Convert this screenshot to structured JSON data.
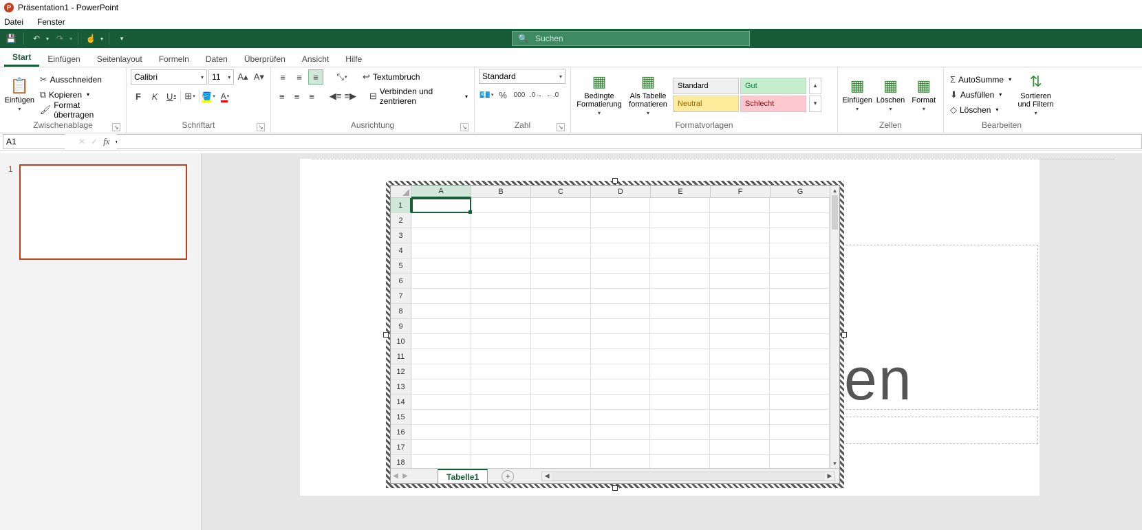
{
  "titlebar": {
    "title": "Präsentation1 - PowerPoint"
  },
  "menubar": {
    "file": "Datei",
    "window": "Fenster"
  },
  "search": {
    "placeholder": "Suchen"
  },
  "tabs": {
    "start": "Start",
    "insert": "Einfügen",
    "pagelayout": "Seitenlayout",
    "formulas": "Formeln",
    "data": "Daten",
    "review": "Überprüfen",
    "view": "Ansicht",
    "help": "Hilfe"
  },
  "clipboard": {
    "paste": "Einfügen",
    "cut": "Ausschneiden",
    "copy": "Kopieren",
    "format_painter": "Format übertragen",
    "group": "Zwischenablage"
  },
  "font": {
    "name": "Calibri",
    "size": "11",
    "group": "Schriftart"
  },
  "alignment": {
    "wrap": "Textumbruch",
    "merge": "Verbinden und zentrieren",
    "group": "Ausrichtung"
  },
  "number": {
    "format": "Standard",
    "group": "Zahl"
  },
  "styles": {
    "cond": "Bedingte Formatierung",
    "table": "Als Tabelle formatieren",
    "standard": "Standard",
    "good": "Gut",
    "neutral": "Neutral",
    "bad": "Schlecht",
    "group": "Formatvorlagen"
  },
  "cells": {
    "insert": "Einfügen",
    "delete": "Löschen",
    "format": "Format",
    "group": "Zellen"
  },
  "editing": {
    "autosum": "AutoSumme",
    "fill": "Ausfüllen",
    "clear": "Löschen",
    "sort": "Sortieren und Filtern",
    "group": "Bearbeiten"
  },
  "namebox": {
    "value": "A1"
  },
  "sheet": {
    "cols": [
      "A",
      "B",
      "C",
      "D",
      "E",
      "F",
      "G"
    ],
    "rows": [
      1,
      2,
      3,
      4,
      5,
      6,
      7,
      8,
      9,
      10,
      11,
      12,
      13,
      14,
      15,
      16,
      17,
      18
    ],
    "tab": "Tabelle1"
  },
  "bgtext": "en",
  "slide_num": "1"
}
